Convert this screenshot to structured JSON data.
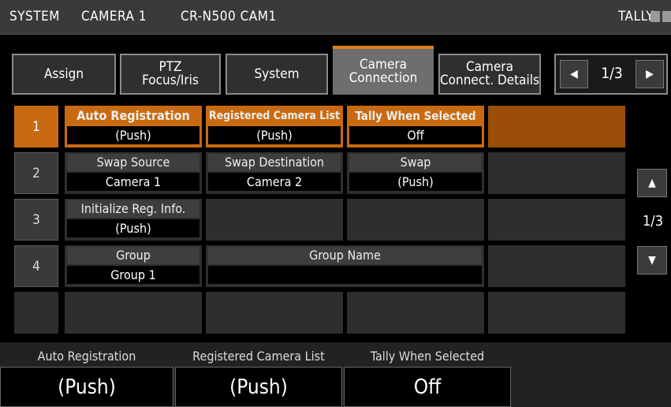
{
  "header": {
    "system_label": "SYSTEM",
    "camera_label": "CAMERA 1",
    "model_label": "CR-N500 CAM1",
    "tally_label": "TALLY"
  },
  "tabs": [
    {
      "line1": "Assign",
      "line2": ""
    },
    {
      "line1": "PTZ",
      "line2": "Focus/Iris"
    },
    {
      "line1": "System",
      "line2": ""
    },
    {
      "line1": "Camera",
      "line2": "Connection"
    },
    {
      "line1": "Camera",
      "line2": "Connect. Details"
    }
  ],
  "tab_nav": {
    "prev_icon": "◀",
    "page": "1/3",
    "next_icon": "▶"
  },
  "rows": [
    {
      "num": "1",
      "cells": [
        {
          "label": "Auto Registration",
          "value": "(Push)"
        },
        {
          "label": "Registered Camera List",
          "value": "(Push)"
        },
        {
          "label": "Tally When Selected",
          "value": "Off"
        }
      ]
    },
    {
      "num": "2",
      "cells": [
        {
          "label": "Swap Source",
          "value": "Camera 1"
        },
        {
          "label": "Swap Destination",
          "value": "Camera 2"
        },
        {
          "label": "Swap",
          "value": "(Push)"
        }
      ]
    },
    {
      "num": "3",
      "cells": [
        {
          "label": "Initialize Reg. Info.",
          "value": "(Push)"
        }
      ]
    },
    {
      "num": "4",
      "cells": [
        {
          "label": "Group",
          "value": "Group 1"
        },
        {
          "label": "Group Name",
          "value": ""
        }
      ]
    }
  ],
  "scroll": {
    "up_icon": "▲",
    "page": "1/3",
    "down_icon": "▼"
  },
  "bottom": [
    {
      "label": "Auto Registration",
      "value": "(Push)"
    },
    {
      "label": "Registered Camera List",
      "value": "(Push)"
    },
    {
      "label": "Tally When Selected",
      "value": "Off"
    }
  ],
  "colors": {
    "accent": "#c96a12",
    "active_tab": "#6e6e6e"
  }
}
